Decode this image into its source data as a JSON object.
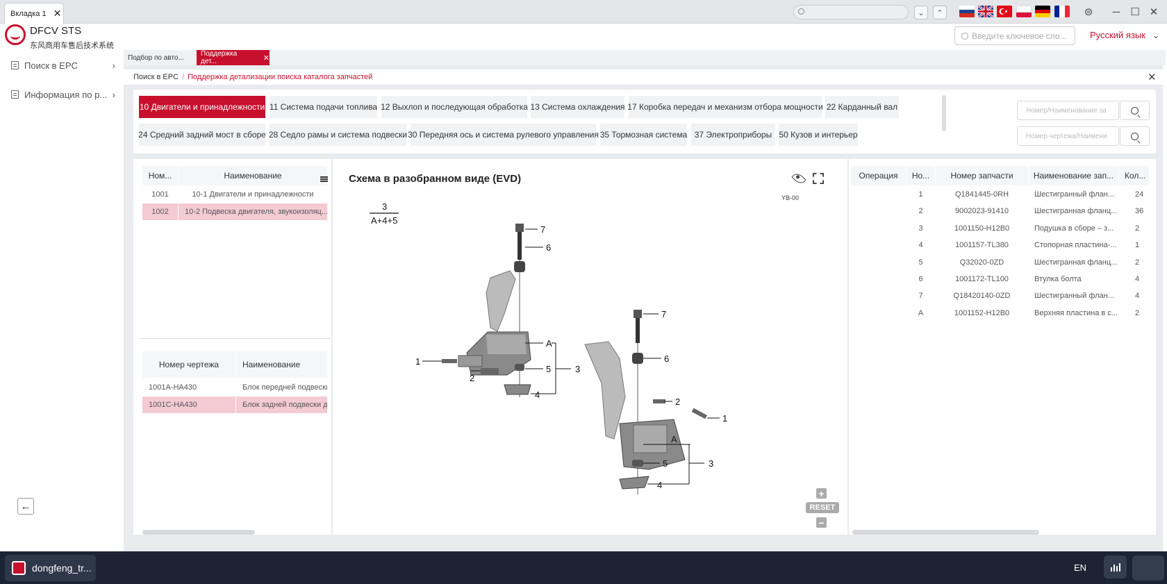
{
  "window": {
    "tab_label": "Вкладка 1"
  },
  "app": {
    "title": "DFCV STS",
    "subtitle": "东风商用车售后技术系统",
    "brand_color": "#c8102e"
  },
  "sidebar": {
    "items": [
      {
        "label": "Поиск в EPC",
        "icon": "document-icon"
      },
      {
        "label": "Информация по р...",
        "icon": "document-icon"
      }
    ]
  },
  "header": {
    "search_placeholder": "Введите ключевое сло...",
    "language": "Русский язык"
  },
  "main_tabs": [
    {
      "label": "Подбор по авто..."
    },
    {
      "label": "Поддержка дет..."
    }
  ],
  "breadcrumb": {
    "root": "Поиск в EPC",
    "separator": "/",
    "current": "Поддержка детализации поиска каталога запчастей"
  },
  "categories": [
    {
      "label": "10 Двигатели и принадлежности"
    },
    {
      "label": "11 Система подачи топлива"
    },
    {
      "label": "12 Выхлоп и последующая обработка"
    },
    {
      "label": "13 Система охлаждения"
    },
    {
      "label": "17 Коробка передач и механизм отбора мощности"
    },
    {
      "label": "22 Карданный вал"
    },
    {
      "label": "24 Средний задний мост в сборе"
    },
    {
      "label": "28 Седло рамы и система подвески"
    },
    {
      "label": "30 Передняя ось и система рулевого управления"
    },
    {
      "label": "35 Тормозная система"
    },
    {
      "label": "37 Электроприборы"
    },
    {
      "label": "50 Кузов и интерьер"
    }
  ],
  "filters": {
    "number_name_placeholder": "Номер/Наименование за",
    "drawing_placeholder": "Номер чертежа/Наимени"
  },
  "groups_table": {
    "headers": [
      "Ном...",
      "Наименование"
    ],
    "rows": [
      {
        "num": "1001",
        "name": "10-1 Двигатели и принадлежности"
      },
      {
        "num": "1002",
        "name": "10-2 Подвеска двигателя, звукоизоляц..."
      }
    ]
  },
  "drawings_table": {
    "headers": [
      "Номер чертежа",
      "Наименование"
    ],
    "rows": [
      {
        "num": "1001A-HA430",
        "name": "Блок передней подвески"
      },
      {
        "num": "1001C-HA430",
        "name": "Блок задней подвески дв"
      }
    ]
  },
  "evd": {
    "title": "Схема в разобранном виде (EVD)",
    "code": "YB-00",
    "formula_top": "3",
    "formula_bottom": "A+4+5",
    "reset_label": "RESET",
    "zoom_in": "+",
    "zoom_out": "−",
    "callouts": [
      "1",
      "2",
      "3",
      "4",
      "5",
      "6",
      "7",
      "A"
    ]
  },
  "parts_table": {
    "headers": [
      "Операция",
      "Но...",
      "Номер запчасти",
      "Наименование зап...",
      "Кол..."
    ],
    "rows": [
      {
        "op": "",
        "num": "1",
        "part": "Q1841445-0RH",
        "name": "Шестигранный флан...",
        "qty": "24"
      },
      {
        "op": "",
        "num": "2",
        "part": "9002023-91410",
        "name": "Шестигранная фланц...",
        "qty": "36"
      },
      {
        "op": "",
        "num": "3",
        "part": "1001150-H12B0",
        "name": "Подушка в сборе – з...",
        "qty": "2"
      },
      {
        "op": "",
        "num": "4",
        "part": "1001157-TL380",
        "name": "Стопорная пластина-...",
        "qty": "1"
      },
      {
        "op": "",
        "num": "5",
        "part": "Q32020-0ZD",
        "name": "Шестигранная фланц...",
        "qty": "2"
      },
      {
        "op": "",
        "num": "6",
        "part": "1001172-TL100",
        "name": "Втулка болта",
        "qty": "4"
      },
      {
        "op": "",
        "num": "7",
        "part": "Q18420140-0ZD",
        "name": "Шестигранный флан...",
        "qty": "4"
      },
      {
        "op": "",
        "num": "A",
        "part": "1001152-H12B0",
        "name": "Верхняя пластина в с...",
        "qty": "2"
      }
    ]
  },
  "taskbar": {
    "app_label": "dongfeng_tr...",
    "lang": "EN"
  }
}
